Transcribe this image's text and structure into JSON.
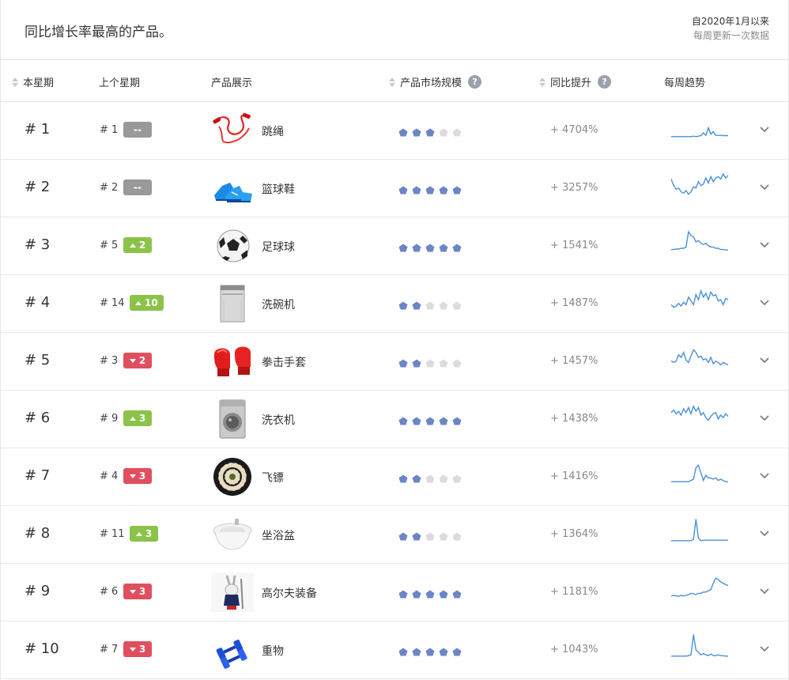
{
  "header": {
    "title": "同比增长率最高的产品。",
    "since": "自2020年1月以来",
    "update": "每周更新一次数据"
  },
  "columns": {
    "this_week": "本星期",
    "last_week": "上个星期",
    "product": "产品展示",
    "market": "产品市场规模",
    "growth": "同比提升",
    "trend": "每周趋势"
  },
  "colors": {
    "star_on": "#6b86c7",
    "star_off": "#dcdcdc",
    "trend_line": "#4a90d9",
    "badge_up": "#8bc34a",
    "badge_down": "#e04f5f",
    "badge_same": "#999999"
  },
  "rows": [
    {
      "rank": "# 1",
      "prev": "# 1",
      "change": "--",
      "dir": "same",
      "product": "跳绳",
      "icon": "jump-rope-icon",
      "stars": 3,
      "growth": "+ 4704%",
      "trend": [
        0.1,
        0.1,
        0.1,
        0.1,
        0.1,
        0.1,
        0.1,
        0.1,
        0.1,
        0.12,
        0.1,
        0.12,
        0.14,
        0.25,
        0.15,
        0.45,
        0.2,
        0.3,
        0.15,
        0.15,
        0.15,
        0.14,
        0.14,
        0.14
      ]
    },
    {
      "rank": "# 2",
      "prev": "# 2",
      "change": "--",
      "dir": "same",
      "product": "篮球鞋",
      "icon": "basketball-shoes-icon",
      "stars": 5,
      "growth": "+ 3257%",
      "trend": [
        0.7,
        0.45,
        0.3,
        0.35,
        0.2,
        0.15,
        0.25,
        0.1,
        0.2,
        0.4,
        0.35,
        0.6,
        0.45,
        0.5,
        0.75,
        0.55,
        0.8,
        0.6,
        0.75,
        0.8,
        0.7,
        0.9,
        0.75,
        0.85
      ]
    },
    {
      "rank": "# 3",
      "prev": "# 5",
      "change": "2",
      "dir": "up",
      "product": "足球球",
      "icon": "soccer-ball-icon",
      "stars": 5,
      "growth": "+ 1541%",
      "trend": [
        0.2,
        0.2,
        0.22,
        0.22,
        0.25,
        0.25,
        0.3,
        0.9,
        0.75,
        0.7,
        0.5,
        0.55,
        0.45,
        0.4,
        0.45,
        0.35,
        0.3,
        0.3,
        0.25,
        0.25,
        0.2,
        0.2,
        0.18,
        0.18
      ]
    },
    {
      "rank": "# 4",
      "prev": "# 14",
      "change": "10",
      "dir": "up",
      "product": "洗碗机",
      "icon": "dishwasher-icon",
      "stars": 2,
      "growth": "+ 1487%",
      "trend": [
        0.3,
        0.2,
        0.25,
        0.35,
        0.25,
        0.4,
        0.3,
        0.6,
        0.45,
        0.3,
        0.7,
        0.5,
        0.85,
        0.6,
        0.75,
        0.5,
        0.8,
        0.65,
        0.7,
        0.45,
        0.5,
        0.3,
        0.55,
        0.5
      ]
    },
    {
      "rank": "# 5",
      "prev": "# 3",
      "change": "2",
      "dir": "down",
      "product": "拳击手套",
      "icon": "boxing-gloves-icon",
      "stars": 2,
      "growth": "+ 1457%",
      "trend": [
        0.35,
        0.3,
        0.35,
        0.6,
        0.5,
        0.7,
        0.4,
        0.3,
        0.55,
        0.8,
        0.7,
        0.5,
        0.55,
        0.4,
        0.45,
        0.3,
        0.5,
        0.25,
        0.35,
        0.3,
        0.2,
        0.3,
        0.25,
        0.2
      ]
    },
    {
      "rank": "# 6",
      "prev": "# 9",
      "change": "3",
      "dir": "up",
      "product": "洗衣机",
      "icon": "washing-machine-icon",
      "stars": 5,
      "growth": "+ 1438%",
      "trend": [
        0.6,
        0.7,
        0.55,
        0.65,
        0.5,
        0.75,
        0.6,
        0.8,
        0.55,
        0.85,
        0.65,
        0.8,
        0.5,
        0.6,
        0.4,
        0.3,
        0.45,
        0.55,
        0.6,
        0.35,
        0.5,
        0.4,
        0.55,
        0.45
      ]
    },
    {
      "rank": "# 7",
      "prev": "# 4",
      "change": "3",
      "dir": "down",
      "product": "飞镖",
      "icon": "dartboard-icon",
      "stars": 2,
      "growth": "+ 1416%",
      "trend": [
        0.15,
        0.15,
        0.15,
        0.15,
        0.15,
        0.15,
        0.15,
        0.15,
        0.2,
        0.25,
        0.7,
        0.8,
        0.5,
        0.2,
        0.4,
        0.3,
        0.3,
        0.25,
        0.3,
        0.2,
        0.25,
        0.2,
        0.15,
        0.15
      ]
    },
    {
      "rank": "# 8",
      "prev": "# 11",
      "change": "3",
      "dir": "up",
      "product": "坐浴盆",
      "icon": "bidet-icon",
      "stars": 2,
      "growth": "+ 1364%",
      "trend": [
        0.1,
        0.1,
        0.1,
        0.1,
        0.1,
        0.1,
        0.1,
        0.1,
        0.1,
        0.15,
        0.95,
        0.2,
        0.1,
        0.12,
        0.12,
        0.12,
        0.12,
        0.12,
        0.12,
        0.12,
        0.12,
        0.12,
        0.12,
        0.12
      ]
    },
    {
      "rank": "# 9",
      "prev": "# 6",
      "change": "3",
      "dir": "down",
      "product": "高尔夫装备",
      "icon": "golf-equipment-icon",
      "stars": 5,
      "growth": "+ 1181%",
      "trend": [
        0.2,
        0.22,
        0.2,
        0.18,
        0.22,
        0.2,
        0.22,
        0.25,
        0.3,
        0.28,
        0.25,
        0.3,
        0.3,
        0.35,
        0.35,
        0.4,
        0.45,
        0.7,
        0.9,
        0.85,
        0.75,
        0.7,
        0.65,
        0.6
      ]
    },
    {
      "rank": "# 10",
      "prev": "# 7",
      "change": "3",
      "dir": "down",
      "product": "重物",
      "icon": "dumbbells-icon",
      "stars": 5,
      "growth": "+ 1043%",
      "trend": [
        0.1,
        0.1,
        0.1,
        0.1,
        0.1,
        0.1,
        0.1,
        0.12,
        0.15,
        0.95,
        0.35,
        0.25,
        0.15,
        0.2,
        0.15,
        0.12,
        0.18,
        0.12,
        0.12,
        0.15,
        0.12,
        0.12,
        0.1,
        0.1
      ]
    }
  ]
}
